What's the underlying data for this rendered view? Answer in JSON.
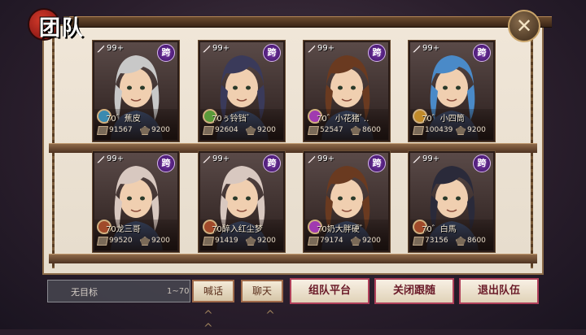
{
  "header": {
    "title": "团队",
    "close_icon": "close-icon"
  },
  "badge_kua": "跨",
  "members": [
    {
      "level": "99+",
      "name": "70゛蕉皮",
      "power": "91567",
      "hp": "9200",
      "hair": "#c8c8c8",
      "role_color": "#3a8ab0"
    },
    {
      "level": "99+",
      "name": "70ぅ铃铛゛",
      "power": "92604",
      "hp": "9200",
      "hair": "#3a3a5a",
      "role_color": "#5a9a3a"
    },
    {
      "level": "99+",
      "name": "70゛小花猪ﾞ‥",
      "power": "52547",
      "hp": "8600",
      "hair": "#6a3a20",
      "role_color": "#a03ab0"
    },
    {
      "level": "99+",
      "name": "70゛小四筒",
      "power": "100439",
      "hp": "9200",
      "hair": "#4a8ac8",
      "role_color": "#c08a2a"
    },
    {
      "level": "99+",
      "name": "70龙三哥",
      "power": "99520",
      "hp": "9200",
      "hair": "#d8c8c0",
      "role_color": "#a04a2a"
    },
    {
      "level": "99+",
      "name": "70醉入红尘梦",
      "power": "91419",
      "hp": "9200",
      "hair": "#d8c8c0",
      "role_color": "#a04a2a"
    },
    {
      "level": "99+",
      "name": "70奶大胖硬゛",
      "power": "79174",
      "hp": "9200",
      "hair": "#6a3a20",
      "role_color": "#a03ab0"
    },
    {
      "level": "99+",
      "name": "70゛白馬",
      "power": "73156",
      "hp": "8600",
      "hair": "#2a2a3a",
      "role_color": "#a04a2a"
    }
  ],
  "footer": {
    "target": "无目标",
    "range": "1~70",
    "shout": "喊话",
    "chat": "聊天",
    "platform": "组队平台",
    "close_follow": "关闭跟随",
    "leave": "退出队伍"
  }
}
